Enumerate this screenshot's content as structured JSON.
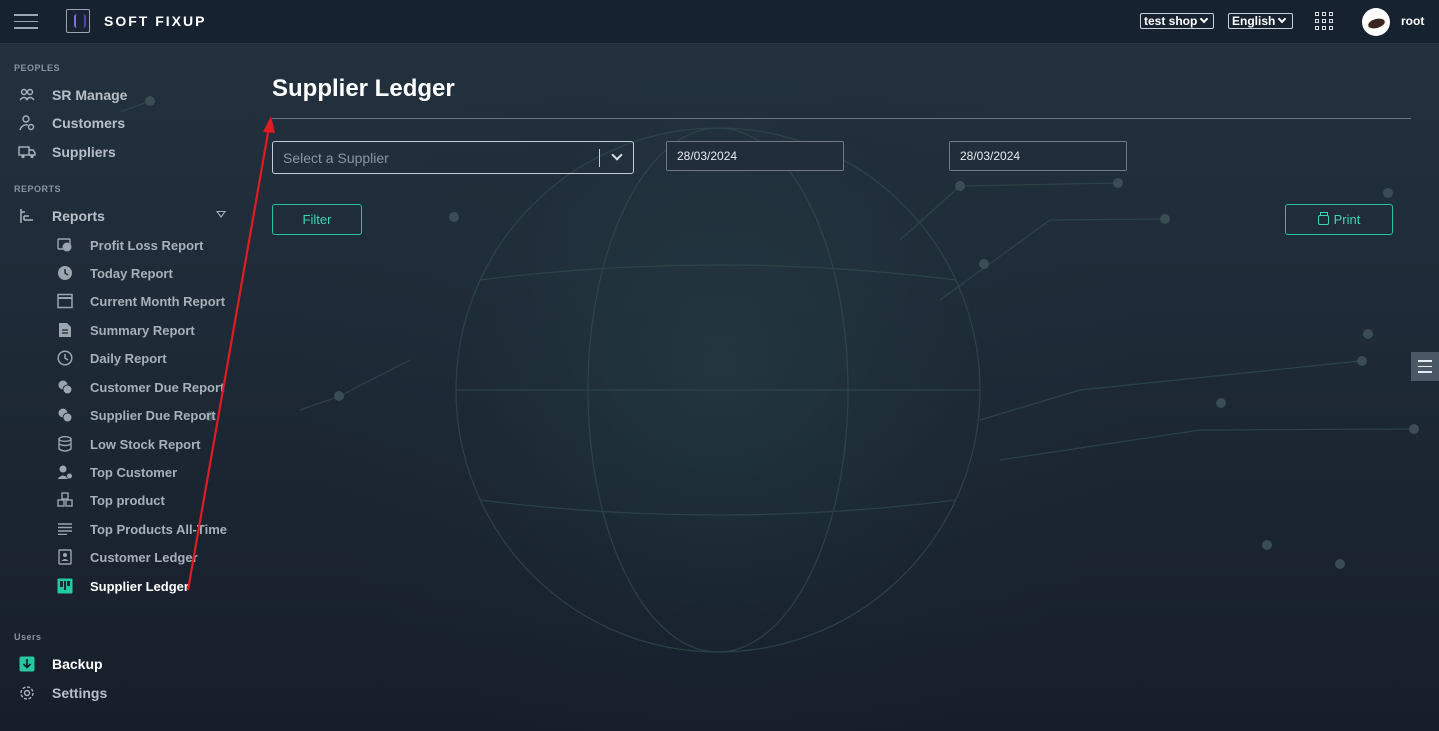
{
  "app": {
    "brand": "SOFT FIXUP"
  },
  "topbar": {
    "shop_select": "test shop",
    "language_select": "English",
    "user": "root"
  },
  "sidebar": {
    "sections": {
      "peoples": "PEOPLES",
      "reports": "REPORTS",
      "users": "Users"
    },
    "people_items": [
      {
        "label": "SR Manage",
        "icon": "users-icon"
      },
      {
        "label": "Customers",
        "icon": "user-gear-icon"
      },
      {
        "label": "Suppliers",
        "icon": "truck-icon"
      }
    ],
    "reports_parent": {
      "label": "Reports",
      "icon": "tree-list-icon"
    },
    "report_items": [
      {
        "label": "Profit Loss Report",
        "icon": "money-icon"
      },
      {
        "label": "Today Report",
        "icon": "clock-icon"
      },
      {
        "label": "Current Month Report",
        "icon": "calendar-icon"
      },
      {
        "label": "Summary Report",
        "icon": "document-icon"
      },
      {
        "label": "Daily Report",
        "icon": "clock-outline-icon"
      },
      {
        "label": "Customer Due Report",
        "icon": "coins-icon"
      },
      {
        "label": "Supplier Due Report",
        "icon": "coins-icon"
      },
      {
        "label": "Low Stock Report",
        "icon": "database-icon"
      },
      {
        "label": "Top Customer",
        "icon": "user-star-icon"
      },
      {
        "label": "Top product",
        "icon": "cubes-icon"
      },
      {
        "label": "Top Products All-Time",
        "icon": "lines-icon"
      },
      {
        "label": "Customer Ledger",
        "icon": "contact-book-icon"
      },
      {
        "label": "Supplier Ledger",
        "icon": "ledger-icon",
        "active": true
      }
    ],
    "user_items": [
      {
        "label": "Backup",
        "icon": "download-icon"
      },
      {
        "label": "Settings",
        "icon": "gear-icon"
      }
    ]
  },
  "main": {
    "title": "Supplier Ledger",
    "supplier_placeholder": "Select a Supplier",
    "date_from": "28/03/2024",
    "date_to": "28/03/2024",
    "filter_label": "Filter",
    "print_label": "Print"
  },
  "colors": {
    "accent": "#26c3a0",
    "annotation_arrow": "#e01b22",
    "background": "#1b2633"
  }
}
